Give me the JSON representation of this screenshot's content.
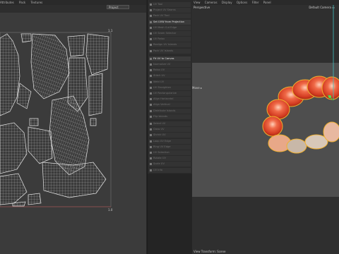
{
  "uv_editor": {
    "menu": [
      "Attributes",
      "Pack",
      "Textures"
    ],
    "project_label": "Project",
    "top_right_label": "1.1",
    "bottom_right_label": "1.0"
  },
  "tools": {
    "items": [
      {
        "label": "UV Tool"
      },
      {
        "label": "Project UV Seams"
      },
      {
        "label": "Pack UV Tool"
      },
      {
        "label": "Set UVW from Projection",
        "highlighted": true
      },
      {
        "label": "UV Mesh Cut Edge"
      },
      {
        "label": "UV Seam Selector"
      },
      {
        "label": "UV Relax"
      },
      {
        "label": "Realign UV Islands"
      },
      {
        "label": "Pack UV Islands"
      },
      {
        "label": "Fit UV to Canvas",
        "highlighted": true
      },
      {
        "label": "Normalize UV"
      },
      {
        "label": "Relax UV"
      },
      {
        "label": "Stitch UV"
      },
      {
        "label": "Weld UV"
      },
      {
        "label": "UV Straighten"
      },
      {
        "label": "UV Rectangularize"
      },
      {
        "label": "Align Horizontal"
      },
      {
        "label": "Align Vertical"
      },
      {
        "label": "Distribute Islands"
      },
      {
        "label": "Flip Islands"
      },
      {
        "label": "Select UV"
      },
      {
        "label": "Grow UV"
      },
      {
        "label": "Shrink UV"
      },
      {
        "label": "Loop UV Edge"
      },
      {
        "label": "Ring UV Edge"
      },
      {
        "label": "UV Selection"
      },
      {
        "label": "Rotate UV"
      },
      {
        "label": "Scale UV"
      },
      {
        "label": "UV Info"
      }
    ]
  },
  "viewport": {
    "menu": [
      "View",
      "Cameras",
      "Display",
      "Options",
      "Filter",
      "Panel"
    ],
    "view_label": "Perspective",
    "camera_label": "Default Camera",
    "side_label": "Move",
    "footer": "View Transform: Scene"
  }
}
